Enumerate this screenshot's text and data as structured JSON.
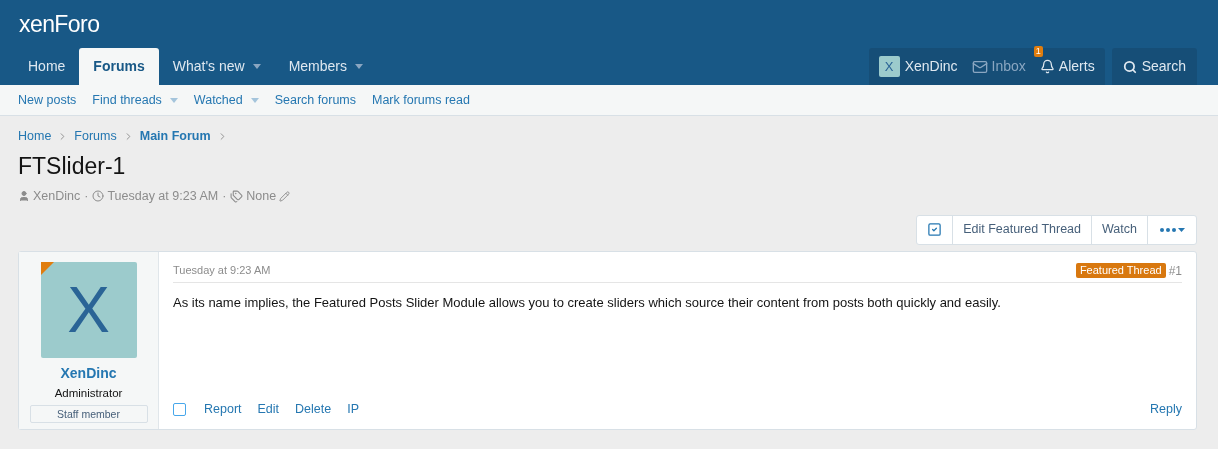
{
  "logo": "xenForo",
  "nav_tabs": [
    {
      "label": "Home",
      "selected": false,
      "has_menu": false
    },
    {
      "label": "Forums",
      "selected": true,
      "has_menu": false
    },
    {
      "label": "What's new",
      "selected": false,
      "has_menu": true
    },
    {
      "label": "Members",
      "selected": false,
      "has_menu": true
    }
  ],
  "account": {
    "avatar_letter": "X",
    "username": "XenDinc",
    "inbox": "Inbox",
    "alerts": "Alerts",
    "alert_count": "1"
  },
  "search": "Search",
  "sub_nav": [
    {
      "label": "New posts",
      "has_menu": false
    },
    {
      "label": "Find threads",
      "has_menu": true
    },
    {
      "label": "Watched",
      "has_menu": true
    },
    {
      "label": "Search forums",
      "has_menu": false
    },
    {
      "label": "Mark forums read",
      "has_menu": false
    }
  ],
  "breadcrumbs": [
    {
      "label": "Home",
      "current": false
    },
    {
      "label": "Forums",
      "current": false
    },
    {
      "label": "Main Forum",
      "current": true
    }
  ],
  "thread": {
    "title": "FTSlider-1",
    "author": "XenDinc",
    "date": "Tuesday at 9:23 AM",
    "tags": "None",
    "separator": "·"
  },
  "thread_actions": [
    "Edit Featured Thread",
    "Watch"
  ],
  "post": {
    "featured": true,
    "avatar_letter": "X",
    "username": "XenDinc",
    "role": "Administrator",
    "banner": "Staff member",
    "date": "Tuesday at 9:23 AM",
    "badge": "Featured Thread",
    "number": "#1",
    "body": "As its name implies, the Featured Posts Slider Module allows you to create sliders which source their content from posts both quickly and easily.",
    "selected": false,
    "actions": [
      "Report",
      "Edit",
      "Delete",
      "IP"
    ],
    "reply": "Reply"
  }
}
